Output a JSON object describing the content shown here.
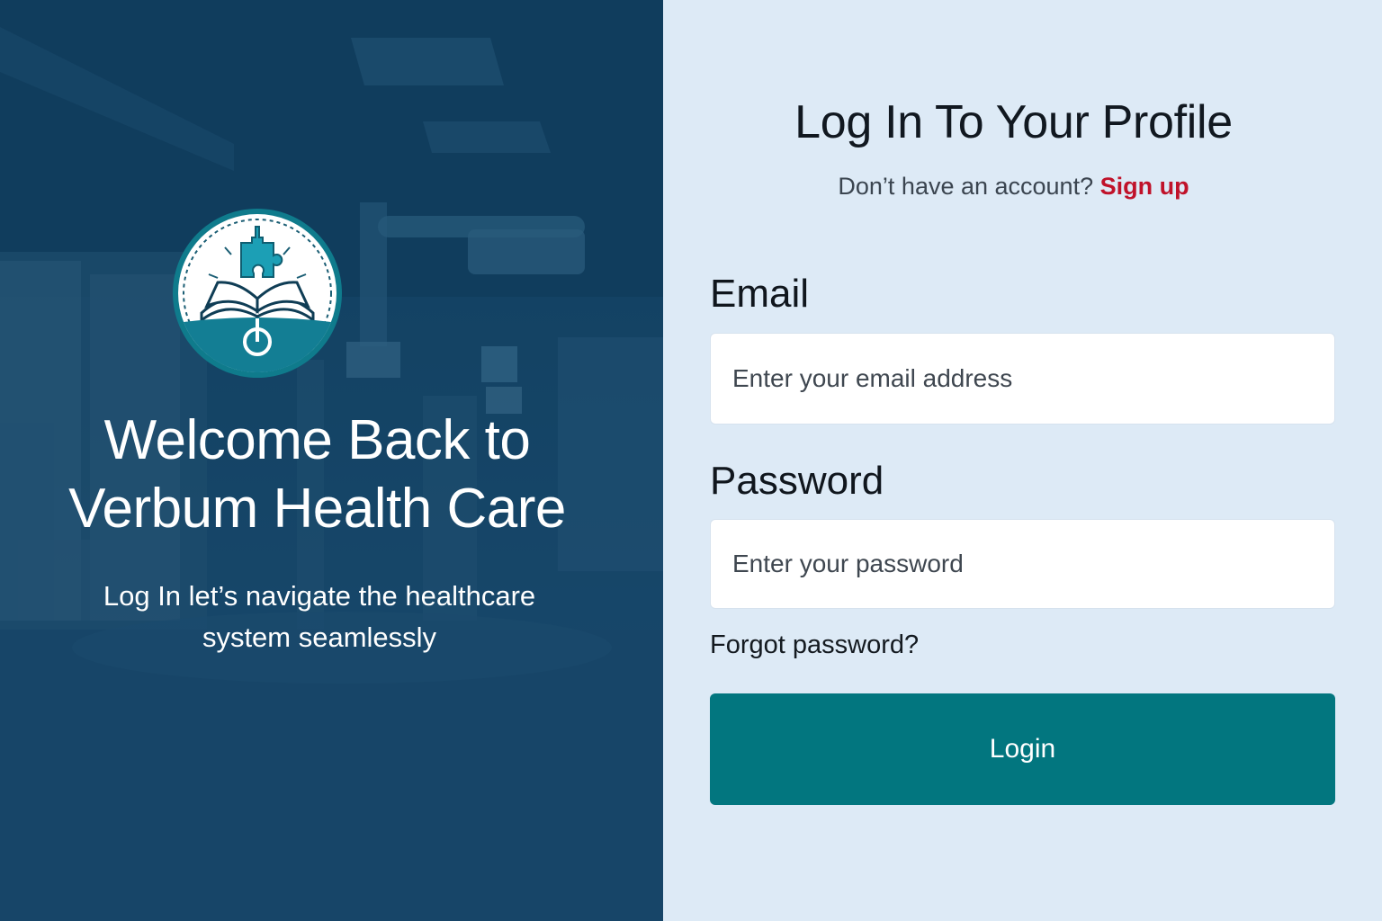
{
  "hero": {
    "title_line1": "Welcome Back to",
    "title_line2": "Verbum Health Care",
    "subtitle_line1": "Log In let’s navigate the healthcare",
    "subtitle_line2": "system seamlessly",
    "logo_icon": "verbum-health-logo-book-puzzle-icon",
    "background": "hospital-room-photo-blue-tint"
  },
  "form": {
    "title": "Log In To Your Profile",
    "signup_prompt": "Don’t have an account?",
    "signup_link": "Sign up",
    "email_label": "Email",
    "email_placeholder": "Enter your email address",
    "email_value": "",
    "password_label": "Password",
    "password_placeholder": "Enter your password",
    "password_value": "",
    "forgot_label": "Forgot password?",
    "login_label": "Login"
  },
  "colors": {
    "hero_bg": "#1a4a6c",
    "panel_bg": "#ddeaf6",
    "accent_teal": "#02767f",
    "link_red": "#c0122a"
  }
}
